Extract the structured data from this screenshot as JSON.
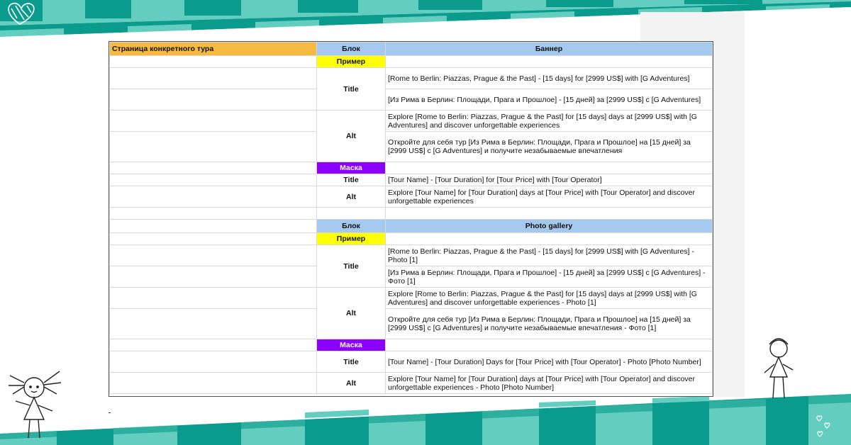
{
  "sheet": {
    "header_left": "Страница конкретного тура",
    "section1": {
      "block_label": "Блок",
      "block_name": "Баннер",
      "example_tag": "Пример",
      "title_label": "Title",
      "alt_label": "Alt",
      "title_en": "[Rome to Berlin: Piazzas, Prague & the Past] - [15 days] for [2999 US$] with [G Adventures]",
      "title_ru": "[Из Рима в Берлин: Площади, Прага и Прошлое] - [15 дней] за [2999 US$] с [G Adventures]",
      "alt_en": "Explore [Rome to Berlin: Piazzas, Prague & the Past] for [15 days] days at [2999 US$] with [G Adventures] and discover unforgettable experiences",
      "alt_ru": "Откройте для себя тур [Из Рима в Берлин: Площади, Прага и Прошлое] на [15 дней] за [2999 US$] с [G Adventures] и получите незабываемые впечатления",
      "mask_tag": "Маска",
      "mask_title": "[Tour Name] - [Tour Duration] for [Tour Price] with [Tour Operator]",
      "mask_alt": "Explore [Tour Name] for [Tour Duration] days at [Tour Price] with [Tour Operator] and discover unforgettable experiences"
    },
    "section2": {
      "block_label": "Блок",
      "block_name": "Photo gallery",
      "example_tag": "Пример",
      "title_label": "Title",
      "alt_label": "Alt",
      "title_en": "[Rome to Berlin: Piazzas, Prague & the Past] - [15 days] for [2999 US$] with [G Adventures] - Photo [1]",
      "title_ru": "[Из Рима в Берлин: Площади, Прага и Прошлое] - [15 дней] за [2999 US$] с [G Adventures] - Фото [1]",
      "alt_en": "Explore [Rome to Berlin: Piazzas, Prague & the Past] for [15 days] days at [2999 US$] with [G Adventures] and discover unforgettable experiences - Photo [1]",
      "alt_ru": "Откройте для себя тур [Из Рима в Берлин: Площади, Прага и Прошлое] на [15 дней] за [2999 US$] с [G Adventures] и получите незабываемые впечатления - Фото [1]",
      "mask_tag": "Маска",
      "mask_title": "[Tour Name] - [Tour Duration] Days for [Tour Price] with [Tour Operator] - Photo [Photo Number]",
      "mask_alt": "Explore [Tour Name] for [Tour Duration] days at [Tour Price] with [Tour Operator] and discover unforgettable experiences - Photo [Photo Number]"
    }
  },
  "colors": {
    "teal_dark": "#0a9b8c",
    "teal_light": "#63cdbf",
    "header_orange": "#f6b942",
    "header_blue": "#a5c8ee",
    "tag_yellow": "#ffff00",
    "tag_purple": "#8b00ff"
  },
  "decor_icons": [
    "heart-icon",
    "girl-doodle-icon",
    "hearts-cluster-icon"
  ]
}
